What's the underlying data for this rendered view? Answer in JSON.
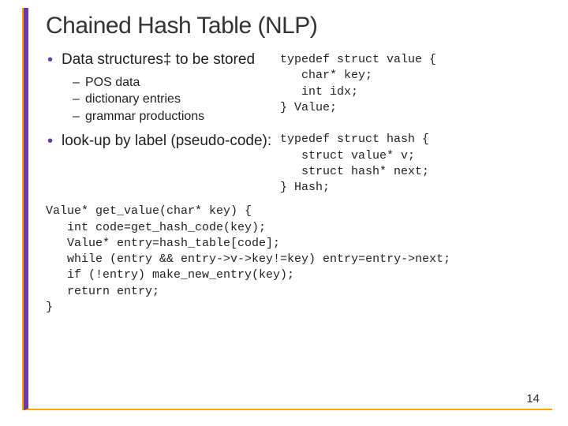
{
  "title": "Chained Hash Table (NLP)",
  "bullets": {
    "b1": "Data structures‡ to be stored",
    "b1_sub": {
      "s1": "POS data",
      "s2": "dictionary entries",
      "s3": "grammar productions"
    },
    "b2": "look-up by label (pseudo-code):"
  },
  "code_right": "typedef struct value {\n   char* key;\n   int idx;\n} Value;\n\ntypedef struct hash {\n   struct value* v;\n   struct hash* next;\n} Hash;",
  "code_bottom": "Value* get_value(char* key) {\n   int code=get_hash_code(key);\n   Value* entry=hash_table[code];\n   while (entry && entry->v->key!=key) entry=entry->next;\n   if (!entry) make_new_entry(key);\n   return entry;\n}",
  "pagenum": "14"
}
